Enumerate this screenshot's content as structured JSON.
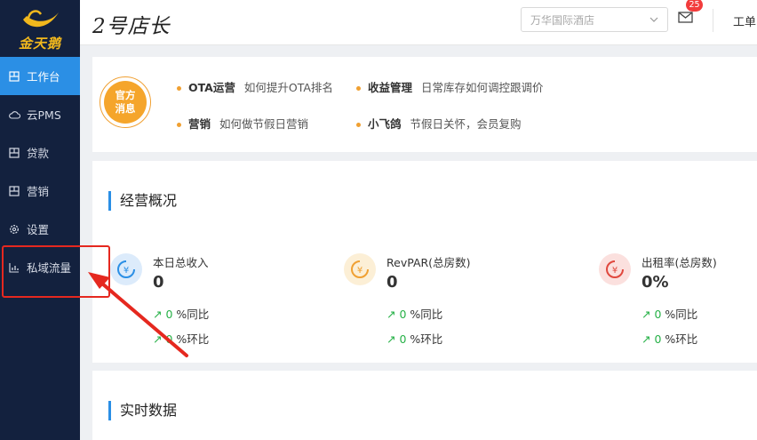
{
  "sidebar": {
    "logo_text": "金天鹅",
    "items": [
      {
        "label": "工作台",
        "icon": "dashboard-icon",
        "active": true
      },
      {
        "label": "云PMS",
        "icon": "cloud-icon",
        "active": false
      },
      {
        "label": "贷款",
        "icon": "dashboard-icon",
        "active": false
      },
      {
        "label": "营销",
        "icon": "dashboard-icon",
        "active": false
      },
      {
        "label": "设置",
        "icon": "gear-icon",
        "active": false
      },
      {
        "label": "私域流量",
        "icon": "chart-icon",
        "active": false
      }
    ]
  },
  "header": {
    "brand": "2号店长",
    "store_select": "万华国际酒店",
    "mail_badge": "25",
    "work": "工单"
  },
  "news": {
    "badge_line1": "官方",
    "badge_line2": "消息",
    "items": [
      {
        "title": "OTA运营",
        "desc": "如何提升OTA排名"
      },
      {
        "title": "收益管理",
        "desc": "日常库存如何调控跟调价"
      },
      {
        "title": "营销",
        "desc": "如何做节假日营销"
      },
      {
        "title": "小飞鸽",
        "desc": "节假日关怀，会员复购"
      }
    ]
  },
  "overview": {
    "title": "经营概况",
    "metrics": [
      {
        "name": "本日总收入",
        "value": "0",
        "yoy": "0",
        "yoy_label": "%同比",
        "mom": "0",
        "mom_label": "%环比",
        "color": "#2b8fe5",
        "bg": "#dcebfb"
      },
      {
        "name": "RevPAR(总房数)",
        "value": "0",
        "yoy": "0",
        "yoy_label": "%同比",
        "mom": "0",
        "mom_label": "%环比",
        "color": "#f0a032",
        "bg": "#fcefd6"
      },
      {
        "name": "出租率(总房数)",
        "value": "0%",
        "yoy": "0",
        "yoy_label": "%同比",
        "mom": "0",
        "mom_label": "%环比",
        "color": "#e0483e",
        "bg": "#fbe0de"
      }
    ]
  },
  "realtime": {
    "title": "实时数据"
  },
  "colors": {
    "sidebar": "#13213e",
    "accent": "#2b8fe5",
    "annotation": "#e5281f",
    "up": "#27b148"
  }
}
